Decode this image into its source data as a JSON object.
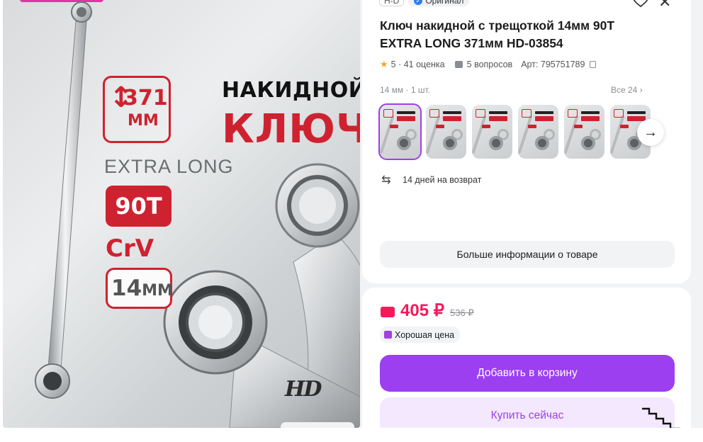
{
  "hero": {
    "length_value": "371",
    "length_unit": "ММ",
    "heading_line1": "НАКИДНОЙ",
    "heading_line2": "КЛЮЧ",
    "extra_long": "EXTRA LONG",
    "teeth": "90T",
    "material": "CrV",
    "size_value": "14",
    "size_unit": "ММ",
    "brand_logo": "HD"
  },
  "header": {
    "brand_chip": "H-D",
    "original_label": "Оригинал",
    "icons": [
      "heart-icon",
      "close-icon"
    ]
  },
  "product": {
    "title_line1": "Ключ накидной с трещоткой 14мм 90Т",
    "title_line2": "EXTRA LONG 371мм HD-03854",
    "rating": "5",
    "rating_count": "· 41 оценка",
    "questions": "5 вопросов",
    "article": "Арт: 795751789"
  },
  "variants": {
    "label": "14 мм · 1 шт.",
    "all_label": "Все 24",
    "thumb_count": 6,
    "selected_index": 0
  },
  "returns": {
    "label": "14 дней на возврат"
  },
  "more_info": {
    "label": "Больше информации о товаре"
  },
  "pricing": {
    "price": "405 ₽",
    "old_price": "536 ₽",
    "good_price_label": "Хорошая цена",
    "add_to_cart": "Добавить в корзину",
    "buy_now": "Купить сейчас"
  },
  "colors": {
    "accent": "#9b3ff0",
    "price": "#f5195a",
    "hero_red": "#cf2230"
  }
}
